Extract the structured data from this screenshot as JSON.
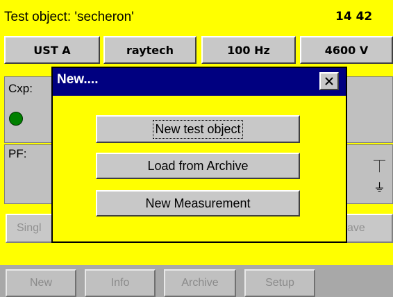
{
  "header": {
    "title": "Test object: 'secheron'",
    "clock": "14 42"
  },
  "settings": [
    "UST A",
    "raytech",
    "100 Hz",
    "4600 V"
  ],
  "panels": {
    "cxp_label": "Cxp:",
    "pf_label": "PF:",
    "indicator_color": "#008000"
  },
  "faded_buttons": {
    "single_partial": "Singl",
    "save_partial": "ave"
  },
  "menu": [
    "New",
    "Info",
    "Archive",
    "Setup"
  ],
  "dialog": {
    "title": "New....",
    "close_icon": "close-icon",
    "buttons": [
      "New test object",
      "Load from Archive",
      "New Measurement"
    ]
  },
  "colors": {
    "background": "#ffff00",
    "titlebar": "#000080"
  }
}
